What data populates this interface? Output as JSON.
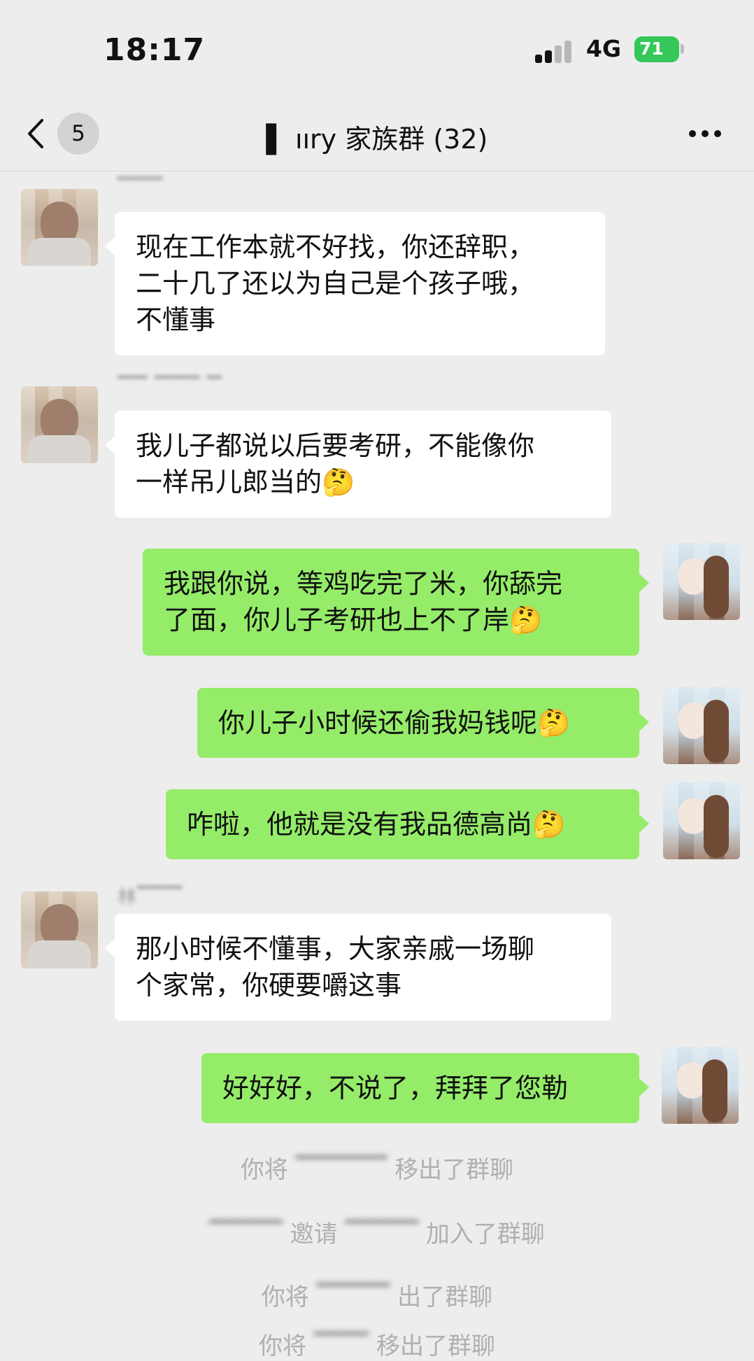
{
  "status_bar": {
    "time": "18:17",
    "network": "4G",
    "battery": "71"
  },
  "nav": {
    "back_count": "5",
    "title": "▌ ııry 家族群 (32)"
  },
  "messages": [
    {
      "side": "left",
      "sender": "▔▔▔",
      "text": "现在工作本就不好找，你还辞职，\n二十几了还以为自己是个孩子哦，\n不懂事"
    },
    {
      "side": "left",
      "sender": "▔▔ ▔▔▔ ▔",
      "text": "我儿子都说以后要考研，不能像你\n一样吊儿郎当的🤔"
    },
    {
      "side": "right",
      "text": "我跟你说，等鸡吃完了米，你舔完\n了面，你儿子考研也上不了岸🤔"
    },
    {
      "side": "right",
      "text": "你儿子小时候还偷我妈钱呢🤔"
    },
    {
      "side": "right",
      "text": "咋啦，他就是没有我品德高尚🤔"
    },
    {
      "side": "left",
      "sender": "林▔▔▔",
      "text": "那小时候不懂事，大家亲戚一场聊\n个家常，你硬要嚼这事"
    },
    {
      "side": "right",
      "text": "好好好，不说了，拜拜了您勒"
    }
  ],
  "system_messages": [
    {
      "prefix": "你将",
      "blurred": "▔▔▔▔▔",
      "suffix": "移出了群聊"
    },
    {
      "prefix": "",
      "blurred": "▔▔▔▔",
      "middle": "邀请",
      "blurred2": "▔▔▔▔",
      "suffix": "加入了群聊"
    },
    {
      "prefix": "你将",
      "blurred": "▔▔▔▔",
      "suffix": "出了群聊"
    },
    {
      "prefix": "你将",
      "blurred": "▔▔▔",
      "suffix": "移出了群聊"
    }
  ]
}
